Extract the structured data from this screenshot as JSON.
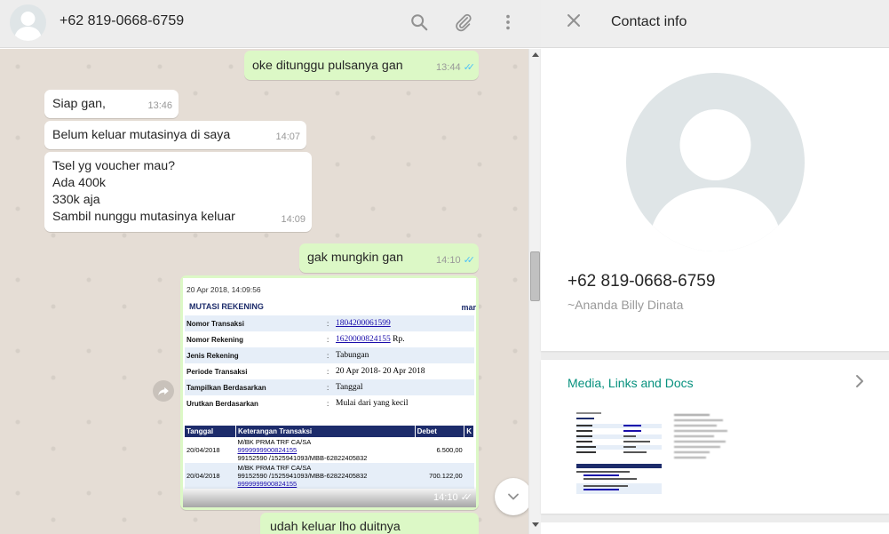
{
  "chat_header": {
    "contact": "+62 819-0668-6759",
    "icons": [
      "search-icon",
      "attach-icon",
      "menu-icon"
    ]
  },
  "messages": [
    {
      "direction": "out",
      "text": "oke ditunggu pulsanya gan",
      "time": "13:44",
      "status": "read"
    },
    {
      "direction": "in",
      "text": "Siap gan,",
      "time": "13:46"
    },
    {
      "direction": "in",
      "text": "Belum keluar mutasinya di saya",
      "time": "14:07"
    },
    {
      "direction": "in",
      "text": "Tsel yg voucher mau?\nAda 400k\n330k aja\nSambil nunggu mutasinya keluar",
      "time": "14:09"
    },
    {
      "direction": "out",
      "text": "gak mungkin gan",
      "time": "14:10",
      "status": "read"
    },
    {
      "direction": "out",
      "type": "image",
      "time": "14:10",
      "status": "read"
    },
    {
      "direction": "out",
      "text": "udah keluar lho duitnya"
    }
  ],
  "image_doc": {
    "date": "20 Apr 2018, 14:09:56",
    "heading": "MUTASI REKENING",
    "brand": "mar",
    "fields": [
      {
        "label": "Nomor Transaksi",
        "value": "1804200061599",
        "link": true
      },
      {
        "label": "Nomor Rekening",
        "value": "1620000824155",
        "suffix": "Rp.",
        "link": true
      },
      {
        "label": "Jenis Rekening",
        "value": "Tabungan"
      },
      {
        "label": "Periode Transaksi",
        "value": "20 Apr 2018- 20 Apr 2018"
      },
      {
        "label": "Tampilkan Berdasarkan",
        "value": "Tanggal"
      },
      {
        "label": "Urutkan Berdasarkan",
        "value": "Mulai dari yang kecil"
      }
    ],
    "table": {
      "headers": [
        "Tanggal",
        "Keterangan Transaksi",
        "Debet",
        "K"
      ],
      "rows": [
        {
          "date": "20/04/2018",
          "line1": "M/BK PRMA TRF CA/SA",
          "link": "9999999900824155",
          "line3": "99152590 /1525941093/MBB-62822405832",
          "debet": "6.500,00"
        },
        {
          "date": "20/04/2018",
          "line1": "M/BK PRMA TRF CA/SA",
          "line2": "99152590 /1525941093/MBB-62822405832",
          "link": "9999999900824155",
          "debet": "700.122,00"
        }
      ]
    }
  },
  "contact_info": {
    "title": "Contact info",
    "phone": "+62 819-0668-6759",
    "name": "~Ananda Billy Dinata",
    "media_title": "Media, Links and Docs"
  },
  "colors": {
    "incoming": "#ffffff",
    "outgoing": "#dcf8c6",
    "chat_bg": "#e5ddd5",
    "read_ticks": "#4fc3f7",
    "teal": "#07917e"
  }
}
